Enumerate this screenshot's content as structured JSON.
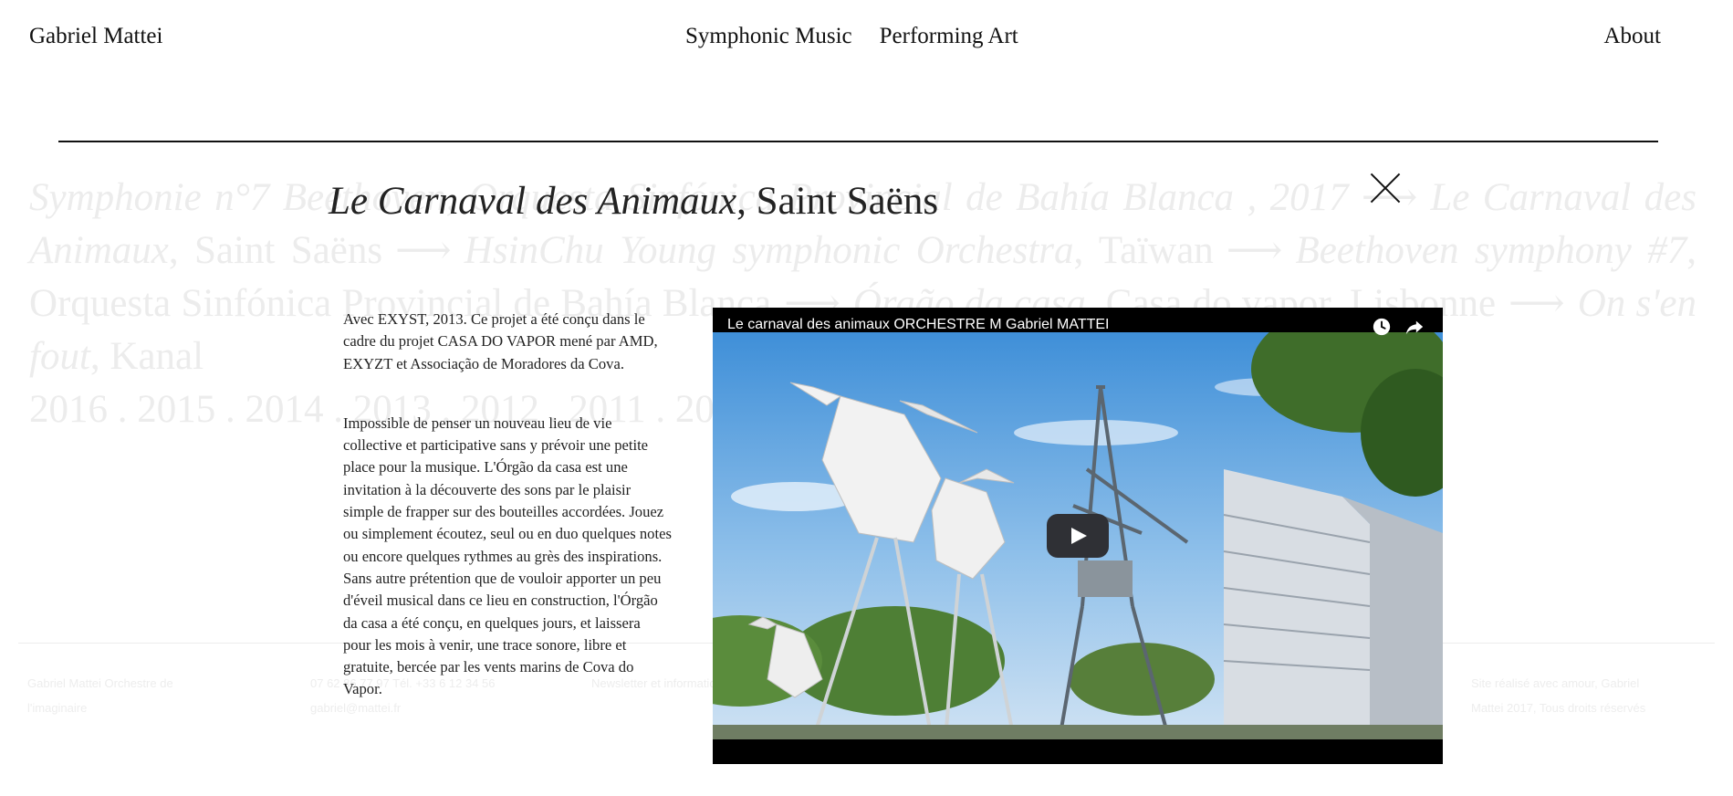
{
  "header": {
    "site_title": "Gabriel Mattei",
    "nav": [
      "Symphonic Music",
      "Performing Art"
    ],
    "about": "About"
  },
  "background": {
    "p1": "Symphonie n°7 Beethoven, Orquesta Sinfónica Provincial de Bahía Blanca , 2017",
    "p2": "Le Carnaval des Animaux",
    "p3": ", Saint Saëns",
    "p4": "HsinChu Young symphonic Orchestra",
    "p5": ", Taïwan",
    "p6": "Beethoven symphony #7",
    "p7": ", Orquesta Sinfónica Provincial de Bahía Blanca",
    "p8": "Órgão da casa",
    "p9": ", Casa do vapor, Lisbonne",
    "p10": "On s'en fout",
    "p11": ", Kanal",
    "years": "2016 . 2015 . 2014 . 2013 . 2012 . 2011 . 2010 . 2009 . 2008 . 2007 . 2006 . 2005 . 2004 ."
  },
  "footer": {
    "col1": "Gabriel Mattei Orchestre de l'imaginaire",
    "col2": "07 62 86 77 97 Tél. +33 6 12 34 56 gabriel@mattei.fr",
    "col3": "Newsletter et informations",
    "col4": "Site réalisé avec amour, Gabriel Mattei 2017, Tous droits réservés"
  },
  "modal": {
    "title_italic": "Le Carnaval des Animaux",
    "title_rest": ", Saint Saëns",
    "paragraph1": "Avec EXYST, 2013. Ce projet a été conçu dans le cadre du projet CASA DO VAPOR mené par AMD, EXYZT et Associação de Moradores da Cova.",
    "paragraph2": "Impossible de penser un nouveau lieu de vie collective et participative sans y prévoir une petite place pour la musique. L'Órgão da casa est une invitation à la découverte des sons par le plaisir simple de frapper sur des bouteilles accordées. Jouez ou simplement écoutez, seul ou en duo quelques notes ou encore quelques rythmes au grès des inspirations. Sans autre prétention que de vouloir apporter un peu d'éveil musical dans ce lieu en construction, l'Órgão da casa a été conçu, en quelques jours, et laissera pour les mois à venir, une trace sonore, libre et gratuite, bercée par les vents marins de Cova do Vapor."
  },
  "video": {
    "title": "Le carnaval des animaux ORCHESTRE M Gabriel MATTEI",
    "icons": [
      "watch-later-icon",
      "share-icon",
      "play-icon"
    ]
  },
  "colors": {
    "text": "#111111",
    "faded": "#ececec",
    "video_bg": "#000000",
    "play_button": "#2f3035"
  }
}
